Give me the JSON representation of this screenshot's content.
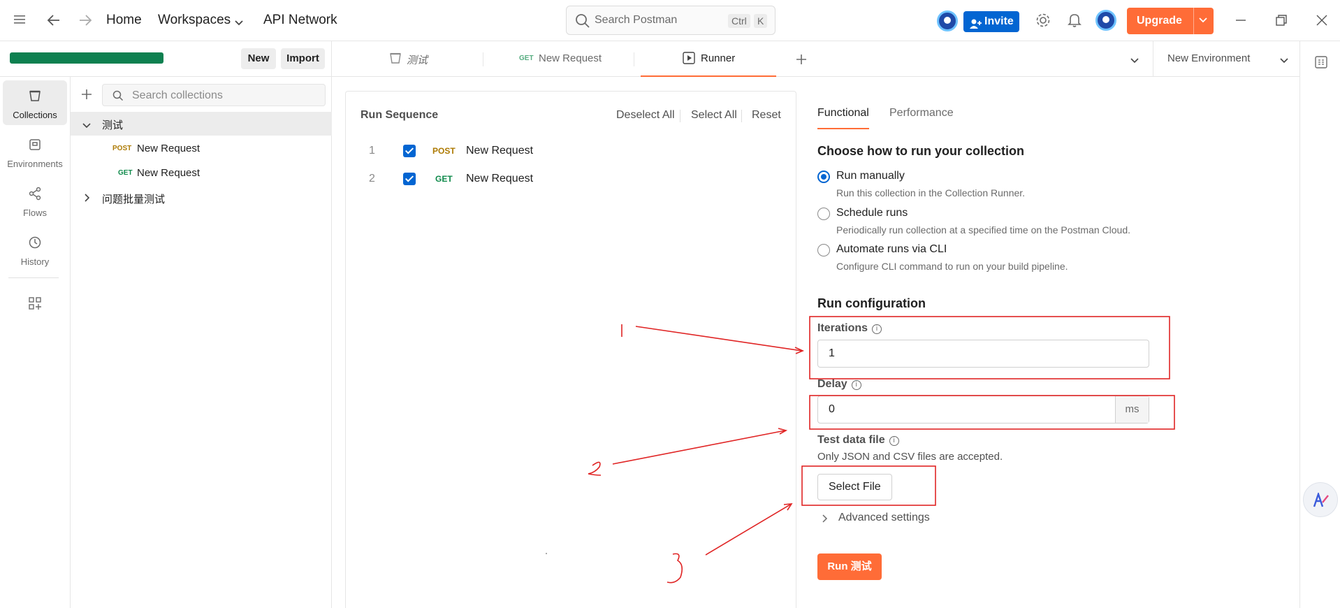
{
  "topbar": {
    "home": "Home",
    "workspaces": "Workspaces",
    "api_network": "API Network",
    "search_placeholder": "Search Postman",
    "kbd_ctrl": "Ctrl",
    "kbd_k": "K",
    "invite": "Invite",
    "upgrade": "Upgrade"
  },
  "workspace": {
    "new_label": "New",
    "import_label": "Import"
  },
  "rail": [
    {
      "label": "Collections",
      "icon": "collections-icon"
    },
    {
      "label": "Environments",
      "icon": "environments-icon"
    },
    {
      "label": "Flows",
      "icon": "flows-icon"
    },
    {
      "label": "History",
      "icon": "history-icon"
    }
  ],
  "sidebar": {
    "search_placeholder": "Search collections",
    "collections": [
      {
        "name": "测试",
        "requests": [
          {
            "method": "POST",
            "name": "New Request"
          },
          {
            "method": "GET",
            "name": "New Request"
          }
        ]
      },
      {
        "name": "问题批量测试"
      }
    ]
  },
  "tabs": [
    {
      "label": "测试"
    },
    {
      "method": "GET",
      "label": "New Request"
    },
    {
      "label": "Runner"
    }
  ],
  "environment": "New Environment",
  "run_sequence": {
    "title": "Run Sequence",
    "deselect_all": "Deselect All",
    "select_all": "Select All",
    "reset": "Reset",
    "rows": [
      {
        "index": "1",
        "method": "POST",
        "name": "New Request",
        "checked": true
      },
      {
        "index": "2",
        "method": "GET",
        "name": "New Request",
        "checked": true
      }
    ]
  },
  "config": {
    "tab_functional": "Functional",
    "tab_performance": "Performance",
    "choose_heading": "Choose how to run your collection",
    "options": [
      {
        "title": "Run manually",
        "desc": "Run this collection in the Collection Runner.",
        "selected": true
      },
      {
        "title": "Schedule runs",
        "desc": "Periodically run collection at a specified time on the Postman Cloud.",
        "selected": false
      },
      {
        "title": "Automate runs via CLI",
        "desc": "Configure CLI command to run on your build pipeline.",
        "selected": false
      }
    ],
    "run_config_heading": "Run configuration",
    "iterations_label": "Iterations",
    "iterations_value": "1",
    "delay_label": "Delay",
    "delay_value": "0",
    "delay_unit": "ms",
    "test_data_label": "Test data file",
    "test_data_hint": "Only JSON and CSV files are accepted.",
    "select_file": "Select File",
    "advanced": "Advanced settings",
    "run_button": "Run 测试"
  },
  "annotations": {
    "color": "#e02424",
    "labels": [
      "1",
      "2",
      "3"
    ]
  },
  "colors": {
    "accent": "#ff6c37",
    "primary": "#0265d2",
    "post": "#ad7a03",
    "get": "#0f8a4b"
  }
}
